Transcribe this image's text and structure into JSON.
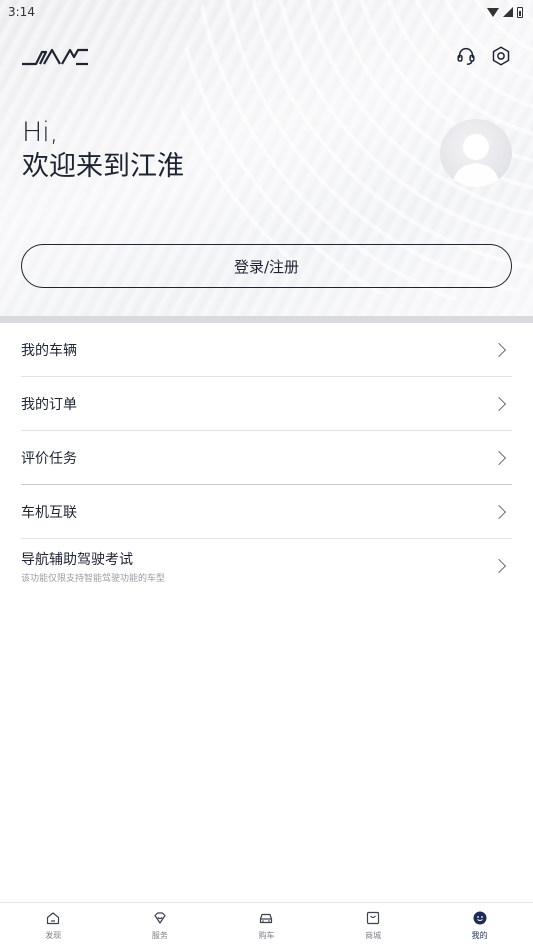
{
  "status_bar": {
    "time": "3:14"
  },
  "header": {
    "logo_alt": "JAC",
    "icons": [
      "headset-icon",
      "settings-icon"
    ]
  },
  "greeting": {
    "line1": "Hi,",
    "line2": "欢迎来到江淮"
  },
  "login_button": {
    "label": "登录/注册"
  },
  "menu": {
    "items": [
      {
        "label": "我的车辆"
      },
      {
        "label": "我的订单"
      },
      {
        "label": "评价任务"
      },
      {
        "label": "车机互联"
      },
      {
        "label": "导航辅助驾驶考试",
        "sublabel": "该功能仅限支持智能驾驶功能的车型"
      }
    ]
  },
  "tab_bar": {
    "tabs": [
      {
        "label": "发现",
        "icon": "home-icon"
      },
      {
        "label": "服务",
        "icon": "service-icon"
      },
      {
        "label": "购车",
        "icon": "car-icon"
      },
      {
        "label": "商城",
        "icon": "shop-icon"
      },
      {
        "label": "我的",
        "icon": "profile-icon"
      }
    ],
    "active": "我的"
  },
  "colors": {
    "primary": "#1f2433",
    "active_tab": "#1f2c57",
    "divider": "#d9dadd"
  }
}
